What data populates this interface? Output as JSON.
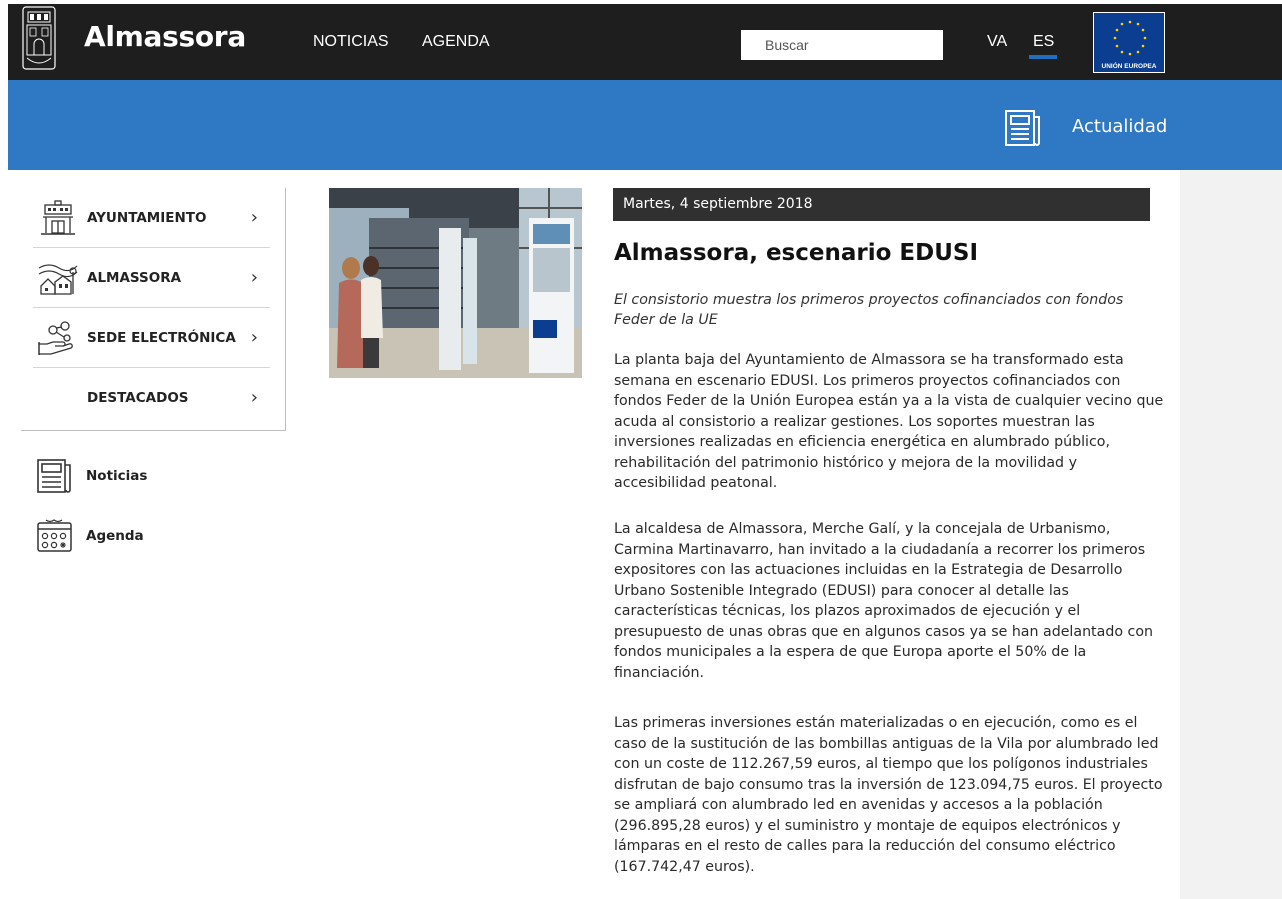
{
  "header": {
    "brand": "Almassora",
    "nav": [
      "NOTICIAS",
      "AGENDA"
    ],
    "search_placeholder": "Buscar",
    "languages": [
      "VA",
      "ES"
    ],
    "active_language": "ES",
    "eu_label": "UNIÓN EUROPEA"
  },
  "banner": {
    "title": "Actualidad",
    "icon": "newspaper-icon"
  },
  "sidebar": {
    "menu": [
      {
        "label": "AYUNTAMIENTO",
        "icon": "town-hall-icon"
      },
      {
        "label": "ALMASSORA",
        "icon": "town-icon"
      },
      {
        "label": "SEDE ELECTRÓNICA",
        "icon": "hand-network-icon"
      },
      {
        "label": "DESTACADOS",
        "icon": ""
      }
    ],
    "chevron": "›",
    "quick_links": [
      {
        "label": "Noticias",
        "icon": "newspaper-icon"
      },
      {
        "label": "Agenda",
        "icon": "calendar-icon"
      }
    ]
  },
  "article": {
    "date": "Martes, 4 septiembre 2018",
    "title": "Almassora, escenario EDUSI",
    "subtitle": "El consistorio muestra los primeros proyectos cofinanciados con fondos Feder de la UE",
    "paragraphs": [
      "La planta baja del Ayuntamiento de Almassora se ha transformado esta semana en escenario EDUSI. Los primeros proyectos cofinanciados con fondos Feder de la Unión Europea están ya a la vista de cualquier vecino que acuda al consistorio a realizar gestiones. Los soportes muestran las inversiones realizadas en eficiencia energética en alumbrado público, rehabilitación del patrimonio histórico y mejora de la movilidad y accesibilidad peatonal.",
      "La alcaldesa de Almassora, Merche Galí, y la concejala de Urbanismo, Carmina Martinavarro, han invitado a la ciudadanía a recorrer los primeros expositores con las actuaciones incluidas en la Estrategia de Desarrollo Urbano Sostenible Integrado (EDUSI) para conocer al detalle las características técnicas, los plazos aproximados de ejecución y el presupuesto de unas obras que en algunos casos ya se han adelantado con fondos municipales a la espera de que Europa aporte el 50% de la financiación.",
      "Las primeras inversiones están materializadas o en ejecución, como es el caso de la sustitución de las bombillas antiguas de la Vila por alumbrado led con un coste de 112.267,59 euros, al tiempo que los polígonos industriales disfrutan de bajo consumo tras la inversión de 123.094,75 euros. El proyecto se ampliará con alumbrado led en avenidas y accesos a la población (296.895,28 euros) y el suministro y montaje de equipos electrónicos y lámparas en el resto de calles para la reducción del consumo eléctrico (167.742,47 euros)."
    ]
  },
  "colors": {
    "header_bg": "#1e1e1e",
    "banner_bg": "#2f78c4",
    "date_bar_bg": "#303030",
    "accent": "#1f6fc1"
  }
}
